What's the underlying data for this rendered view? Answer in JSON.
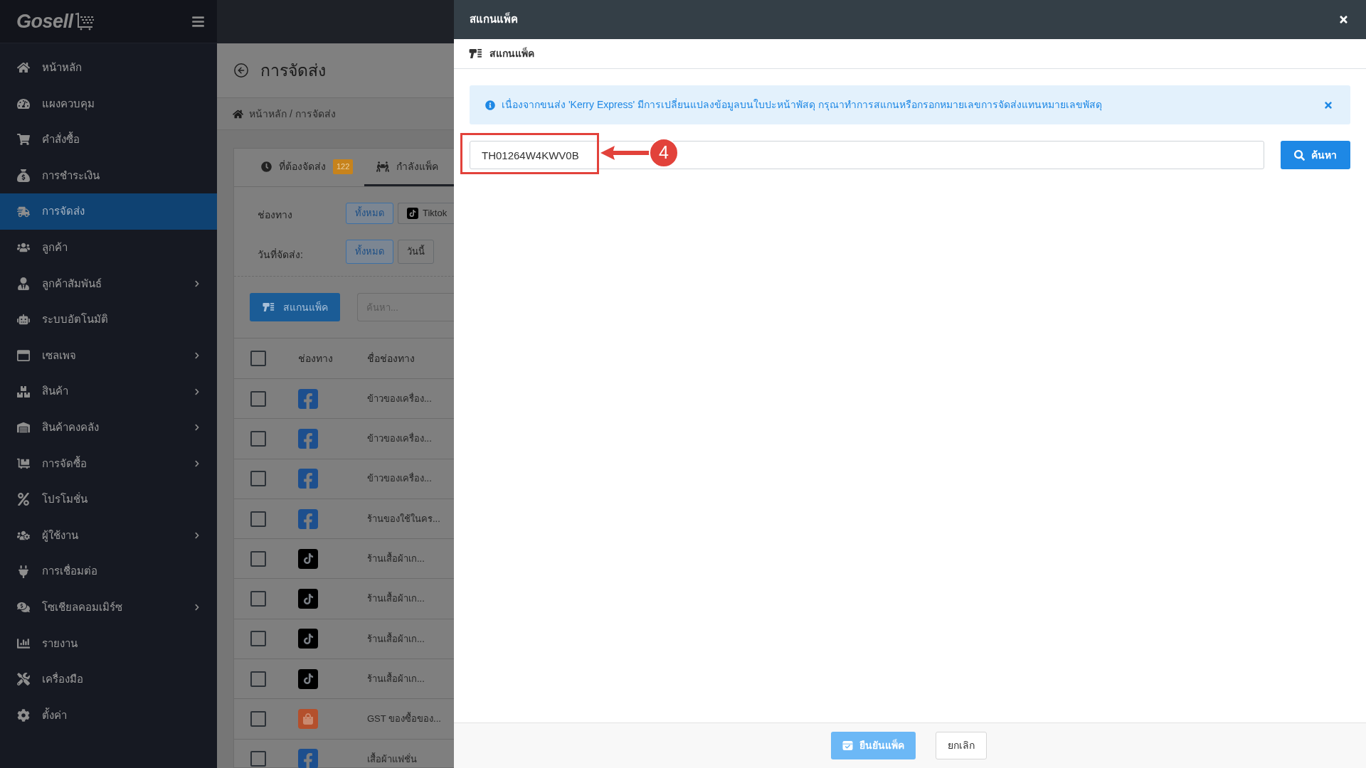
{
  "sidebar": {
    "logo": "Gosell",
    "items": [
      {
        "label": "หน้าหลัก",
        "selected": false,
        "submenu": false
      },
      {
        "label": "แผงควบคุม",
        "selected": false,
        "submenu": false
      },
      {
        "label": "คำสั่งซื้อ",
        "selected": false,
        "submenu": false
      },
      {
        "label": "การชำระเงิน",
        "selected": false,
        "submenu": false
      },
      {
        "label": "การจัดส่ง",
        "selected": true,
        "submenu": false
      },
      {
        "label": "ลูกค้า",
        "selected": false,
        "submenu": false
      },
      {
        "label": "ลูกค้าสัมพันธ์",
        "selected": false,
        "submenu": true
      },
      {
        "label": "ระบบอัตโนมัติ",
        "selected": false,
        "submenu": false
      },
      {
        "label": "เซลเพจ",
        "selected": false,
        "submenu": true
      },
      {
        "label": "สินค้า",
        "selected": false,
        "submenu": true
      },
      {
        "label": "สินค้าคงคลัง",
        "selected": false,
        "submenu": true
      },
      {
        "label": "การจัดซื้อ",
        "selected": false,
        "submenu": true
      },
      {
        "label": "โปรโมชั่น",
        "selected": false,
        "submenu": false
      },
      {
        "label": "ผู้ใช้งาน",
        "selected": false,
        "submenu": true
      },
      {
        "label": "การเชื่อมต่อ",
        "selected": false,
        "submenu": false
      },
      {
        "label": "โซเชียลคอมเมิร์ซ",
        "selected": false,
        "submenu": true
      },
      {
        "label": "รายงาน",
        "selected": false,
        "submenu": false
      },
      {
        "label": "เครื่องมือ",
        "selected": false,
        "submenu": false
      },
      {
        "label": "ตั้งค่า",
        "selected": false,
        "submenu": false
      }
    ]
  },
  "page": {
    "title": "การจัดส่ง",
    "breadcrumb": "หน้าหลัก / การจัดส่ง",
    "tabs": [
      {
        "label": "ที่ต้องจัดส่ง",
        "badge": "122",
        "selected": false
      },
      {
        "label": "กำลังแพ็ค",
        "selected": true
      }
    ],
    "filters": [
      {
        "label": "ช่องทาง",
        "options": [
          {
            "label": "ทั้งหมด",
            "kind": "plain",
            "selected": true
          },
          {
            "label": "Tiktok",
            "kind": "tiktok",
            "selected": false
          }
        ]
      },
      {
        "label": "วันที่จัดส่ง:",
        "options": [
          {
            "label": "ทั้งหมด",
            "kind": "plain",
            "selected": true
          },
          {
            "label": "วันนี้",
            "kind": "plain",
            "selected": false
          }
        ]
      }
    ],
    "scan_button": "สแกนแพ็ค",
    "search": {
      "placeholder": "ค้นหา..."
    },
    "table": {
      "header_checked": false,
      "columns": [
        "ช่องทาง",
        "ชื่อช่องทาง"
      ],
      "rows": [
        {
          "kind": "facebook",
          "name": "ข้าวของเครื่อง...",
          "checked": false
        },
        {
          "kind": "facebook",
          "name": "ข้าวของเครื่อง...",
          "checked": false
        },
        {
          "kind": "facebook",
          "name": "ข้าวของเครื่อง...",
          "checked": false
        },
        {
          "kind": "facebook",
          "name": "ร้านของใช้ในคร...",
          "checked": false
        },
        {
          "kind": "tiktok",
          "name": "ร้านเสื้อผ้าเก...",
          "checked": false
        },
        {
          "kind": "tiktok",
          "name": "ร้านเสื้อผ้าเก...",
          "checked": false
        },
        {
          "kind": "tiktok",
          "name": "ร้านเสื้อผ้าเก...",
          "checked": false
        },
        {
          "kind": "tiktok",
          "name": "ร้านเสื้อผ้าเก...",
          "checked": false
        },
        {
          "kind": "shopee",
          "name": "GST ของซื้อของ...",
          "checked": false
        },
        {
          "kind": "facebook",
          "name": "เสื้อผ้าแฟชั่น",
          "checked": false
        }
      ]
    }
  },
  "modal": {
    "title": "สแกนแพ็ค",
    "section": "สแกนแพ็ค",
    "alert": "เนื่องจากขนส่ง 'Kerry Express' มีการเปลี่ยนแปลงข้อมูลบนใบปะหน้าพัสดุ กรุณาทำการสแกนหรือกรอกหมายเลขการจัดส่งแทนหมายเลขพัสดุ",
    "input": {
      "value": "TH01264W4KWV0B"
    },
    "search_button": "ค้นหา",
    "buttons": [
      {
        "label": "ยืนยันแพ็ค",
        "kind": "primary",
        "disabled": true
      },
      {
        "label": "ยกเลิก",
        "kind": "secondary",
        "disabled": false
      }
    ]
  },
  "annotation": {
    "label": "4"
  }
}
